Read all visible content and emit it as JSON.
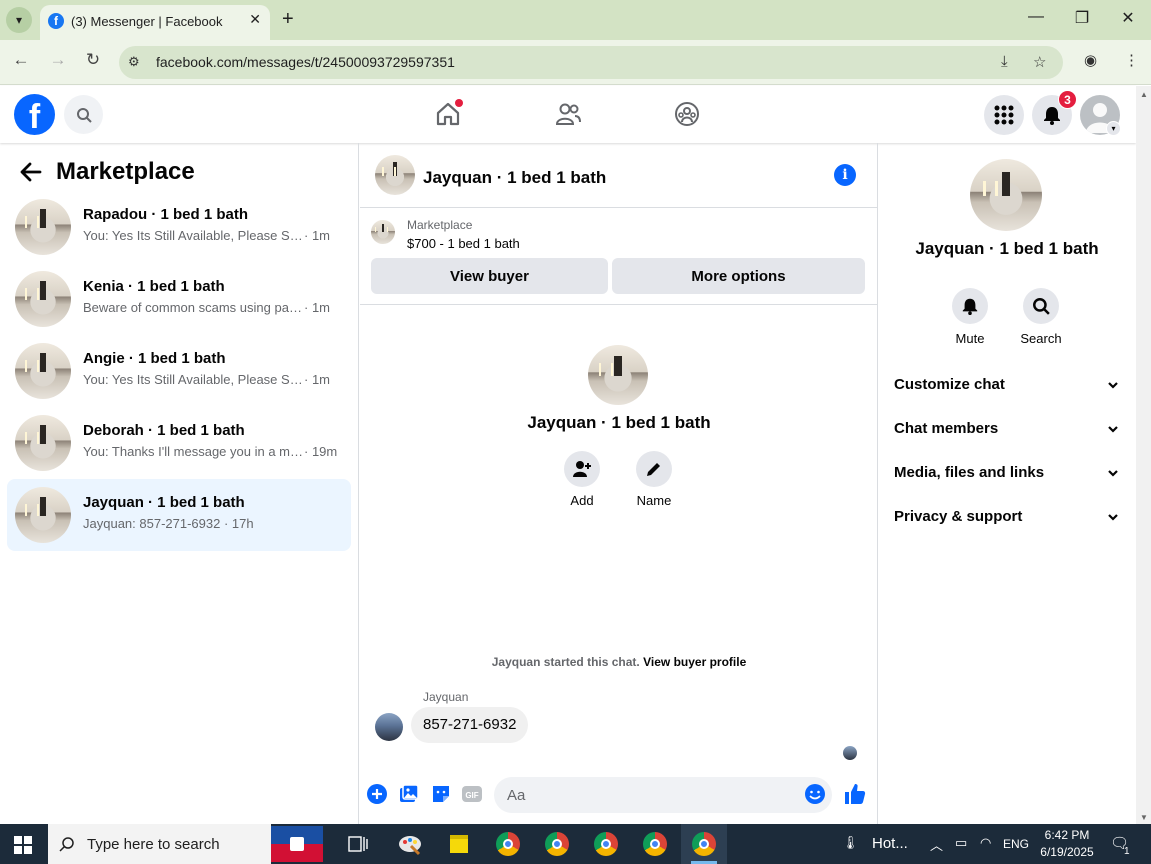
{
  "browser": {
    "tab_title": "(3) Messenger | Facebook",
    "url": "facebook.com/messages/t/24500093729597351"
  },
  "fb_header": {
    "notification_count": "3"
  },
  "left_panel": {
    "title": "Marketplace",
    "conversations": [
      {
        "name": "Rapadou · 1 bed 1 bath",
        "preview": "You: Yes Its Still Available, Please Send Your Email",
        "time": "· 1m"
      },
      {
        "name": "Kenia · 1 bed 1 bath",
        "preview": "Beware of common scams using payment apps",
        "time": "· 1m"
      },
      {
        "name": "Angie · 1 bed 1 bath",
        "preview": "You: Yes Its Still Available, Please Send Your Email",
        "time": "· 1m"
      },
      {
        "name": "Deborah · 1 bed 1 bath",
        "preview": "You: Thanks I'll message you in a minute",
        "time": "· 19m"
      },
      {
        "name": "Jayquan · 1 bed 1 bath",
        "preview": "Jayquan: 857-271-6932 · 17h",
        "time": ""
      }
    ]
  },
  "chat": {
    "title": "Jayquan · 1 bed 1 bath",
    "listing_label": "Marketplace",
    "listing_price": "$700 - 1 bed 1 bath",
    "view_buyer": "View buyer",
    "more_options": "More options",
    "center_name": "Jayquan · 1 bed 1 bath",
    "add_label": "Add",
    "name_label": "Name",
    "started_text": "Jayquan started this chat.",
    "view_profile": "View buyer profile",
    "sender": "Jayquan",
    "message": "857-271-6932",
    "input_placeholder": "Aa"
  },
  "right_panel": {
    "name": "Jayquan · 1 bed 1 bath",
    "mute": "Mute",
    "search": "Search",
    "sections": [
      "Customize chat",
      "Chat members",
      "Media, files and links",
      "Privacy & support"
    ]
  },
  "taskbar": {
    "search_placeholder": "Type here to search",
    "weather": "Hot...",
    "lang": "ENG",
    "time": "6:42 PM",
    "date": "6/19/2025",
    "notif_count": "1"
  }
}
